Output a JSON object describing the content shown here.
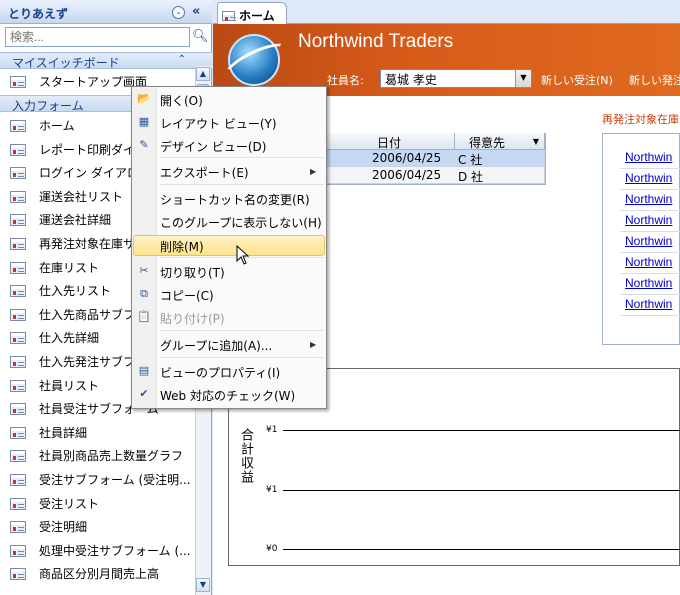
{
  "nav": {
    "title": "とりあえず",
    "search_placeholder": "検索...",
    "collapse": "«",
    "dropdown": "⌄",
    "search_icon": "magnifier-icon",
    "groups": [
      {
        "label": "マイスイッチボード",
        "chev": "⌃"
      },
      {
        "label": "入力フォーム",
        "chev": "⌃"
      }
    ],
    "switchboard_items": [
      "スタートアップ画面"
    ],
    "forms": [
      "ホーム",
      "レポート印刷ダイアログ",
      "ログイン ダイアログ",
      "運送会社リスト",
      "運送会社詳細",
      "再発注対象在庫サブフォーム",
      "在庫リスト",
      "仕入先リスト",
      "仕入先商品サブフォーム",
      "仕入先詳細",
      "仕入先発注サブフォーム",
      "社員リスト",
      "社員受注サブフォーム",
      "社員詳細",
      "社員別商品売上数量グラフ",
      "受注サブフォーム (受注明...",
      "受注リスト",
      "受注明細",
      "処理中受注サブフォーム (...",
      "商品区分別月間売上高"
    ]
  },
  "tab": {
    "label": "ホーム"
  },
  "header": {
    "app_name": "Northwind Traders",
    "employee_label": "社員名:",
    "employee_value": "葛城 孝史",
    "link_new_order": "新しい受注(N)",
    "link_new_order2": "新しい発注"
  },
  "orders": {
    "columns": [
      "日付",
      "得意先"
    ],
    "rows": [
      [
        "2006/04/25",
        "C 社"
      ],
      [
        "2006/04/25",
        "D 社"
      ]
    ]
  },
  "reorder_title": "再発注対象在庫",
  "right_links": [
    "Northwin",
    "Northwin",
    "Northwin",
    "Northwin",
    "Northwin",
    "Northwin",
    "Northwin",
    "Northwin"
  ],
  "chart_data": {
    "type": "line",
    "ylabel": "合計収益",
    "ticks": [
      "¥1",
      "¥1",
      "¥0"
    ]
  },
  "menu": {
    "items": [
      {
        "label": "開く(O)",
        "icon": "open-icon"
      },
      {
        "label": "レイアウト ビュー(Y)",
        "icon": "layout-view-icon"
      },
      {
        "label": "デザイン ビュー(D)",
        "icon": "design-view-icon"
      },
      {
        "label": "エクスポート(E)",
        "icon": "export-icon",
        "submenu": true
      },
      {
        "label": "ショートカット名の変更(R)"
      },
      {
        "label": "このグループに表示しない(H)"
      },
      {
        "label": "削除(M)",
        "highlighted": true
      },
      {
        "label": "切り取り(T)",
        "icon": "scissors-icon"
      },
      {
        "label": "コピー(C)",
        "icon": "copy-icon"
      },
      {
        "label": "貼り付け(P)",
        "icon": "paste-icon",
        "disabled": true
      },
      {
        "label": "グループに追加(A)...",
        "submenu": true
      },
      {
        "label": "ビューのプロパティ(I)",
        "icon": "properties-icon"
      },
      {
        "label": "Web 対応のチェック(W)",
        "icon": "web-check-icon"
      }
    ]
  }
}
